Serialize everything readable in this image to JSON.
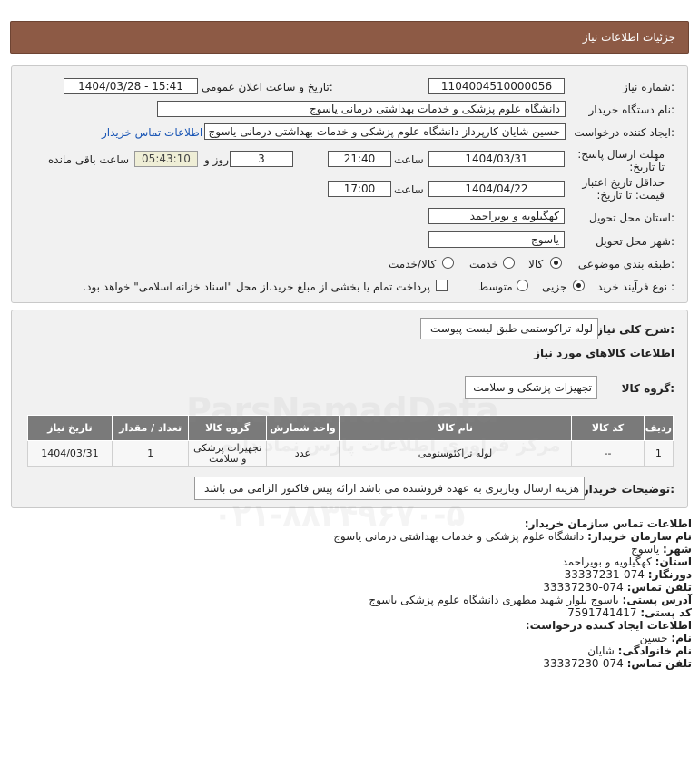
{
  "header": {
    "title": "جزئیات اطلاعات نیاز"
  },
  "form": {
    "need_number_label": "شماره نیاز:",
    "need_number": "1104004510000056",
    "announce_label": "تاریخ و ساعت اعلان عمومی:",
    "announce_value": "1404/03/28 - 15:41",
    "buyer_org_label": "نام دستگاه خریدار:",
    "buyer_org": "دانشگاه علوم پزشکی و خدمات بهداشتی  درمانی یاسوج",
    "creator_label": "ایجاد کننده درخواست:",
    "creator": "حسین شایان کارپرداز دانشگاه علوم پزشکی و خدمات بهداشتی  درمانی یاسوج",
    "contact_link": "اطلاعات تماس خریدار",
    "deadline_label": "مهلت ارسال پاسخ: تا تاریخ:",
    "deadline_date": "1404/03/31",
    "time_label": "ساعت",
    "deadline_time": "21:40",
    "days_value": "3",
    "days_label": "روز و",
    "remaining_time": "05:43:10",
    "remaining_label": "ساعت باقی مانده",
    "validity_label": "حداقل تاریخ اعتبار قیمت: تا تاریخ:",
    "validity_date": "1404/04/22",
    "validity_time": "17:00",
    "province_label": "استان محل تحویل:",
    "province": "کهگیلویه و بویراحمد",
    "city_label": "شهر محل تحویل:",
    "city": "یاسوج",
    "category_label": "طبقه بندی موضوعی:",
    "category_options": [
      "کالا",
      "خدمت",
      "کالا/خدمت"
    ],
    "process_label": "نوع فرآیند خرید :",
    "process_options": [
      "جزیی",
      "متوسط"
    ],
    "treasury_note": "پرداخت تمام یا بخشی از مبلغ خرید،از محل \"اسناد خزانه اسلامی\" خواهد بود."
  },
  "summary": {
    "desc_label": "شرح کلی نیاز:",
    "desc_value": "لوله تراکوستمی طبق لیست پیوست",
    "goods_info_title": "اطلاعات کالاهای مورد نیاز",
    "group_label": "گروه کالا:",
    "group_value": "تجهیزات پزشکی و سلامت",
    "table": {
      "headers": [
        "ردیف",
        "کد کالا",
        "نام کالا",
        "واحد شمارش",
        "گروه کالا",
        "تعداد / مقدار",
        "تاریخ نیاز"
      ],
      "rows": [
        [
          "1",
          "--",
          "لوله تراکئوستومی",
          "عدد",
          "تجهیزات پزشکی و سلامت",
          "1",
          "1404/03/31"
        ]
      ]
    },
    "buyer_notes_label": "توضیحات خریدار:",
    "buyer_notes": "هزینه ارسال وباربری به عهده فروشنده می باشد ارائه پیش فاکتور الزامی می باشد"
  },
  "contact": {
    "title": "اطلاعات تماس سازمان خریدار:",
    "org_name_label": "نام سازمان خریدار:",
    "org_name": "دانشگاه علوم پزشکی و خدمات بهداشتی درمانی یاسوج",
    "city_label": "شهر:",
    "city": "یاسوج",
    "province_label": "استان:",
    "province": "کهگیلویه و بویراحمد",
    "fax_label": "دورنگار:",
    "fax": "074-33337231",
    "phone_label": "تلفن تماس:",
    "phone": "074-33337230",
    "address_label": "آدرس پستی:",
    "address": "یاسوج بلوار شهید مطهری دانشگاه علوم پزشکی یاسوج",
    "postal_label": "کد پستی:",
    "postal": "7591741417",
    "creator_title": "اطلاعات ایجاد کننده درخواست:",
    "first_name_label": "نام:",
    "first_name": "حسین",
    "last_name_label": "نام خانوادگی:",
    "last_name": "شایان",
    "creator_phone_label": "تلفن تماس:",
    "creator_phone": "074-33337230"
  },
  "watermark": {
    "brand": "ParsNamadData",
    "tagline": "مرکز فراوری اطلاعات پارس نماد داده",
    "number": "۰۲۱-۸۸۳۴۹۶۷۰-۵"
  }
}
